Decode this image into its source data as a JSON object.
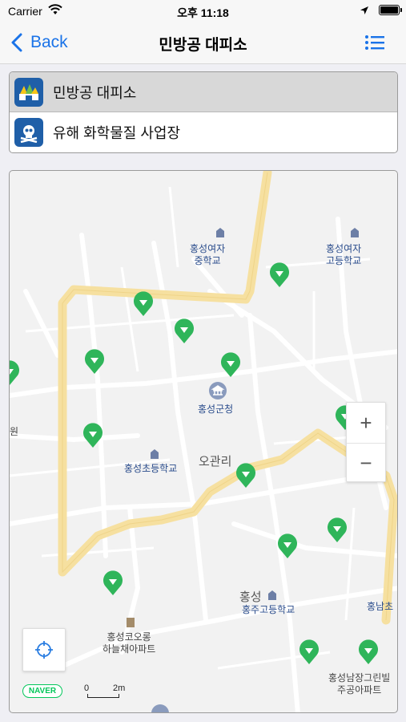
{
  "status": {
    "carrier": "Carrier",
    "time": "오후 11:18"
  },
  "nav": {
    "back_label": "Back",
    "title": "민방공 대피소"
  },
  "categories": [
    {
      "label": "민방공 대피소",
      "selected": true,
      "icon": "shelter-icon"
    },
    {
      "label": "유해 화학물질 사업장",
      "selected": false,
      "icon": "skull-icon"
    }
  ],
  "map": {
    "labels": {
      "girls_middle": "홍성여자\n중학교",
      "girls_high": "홍성여자\n고등학교",
      "county_office": "홍성군청",
      "elementary": "홍성초등학교",
      "ogwan": "오관리",
      "won": "원",
      "hongseong": "홍성",
      "hongju_high": "홍주고등학교",
      "hongnam": "홍남초",
      "kolon": "홍성코오롱\n하늘채아파트",
      "namjang": "홍성남장그린빌\n주공아파트"
    },
    "zoom_in": "+",
    "zoom_out": "−",
    "logo": "NAVER",
    "scale_zero": "0",
    "scale_value": "2m",
    "pin_color": "#2fb55a",
    "road_color": "#f6e0a0"
  }
}
